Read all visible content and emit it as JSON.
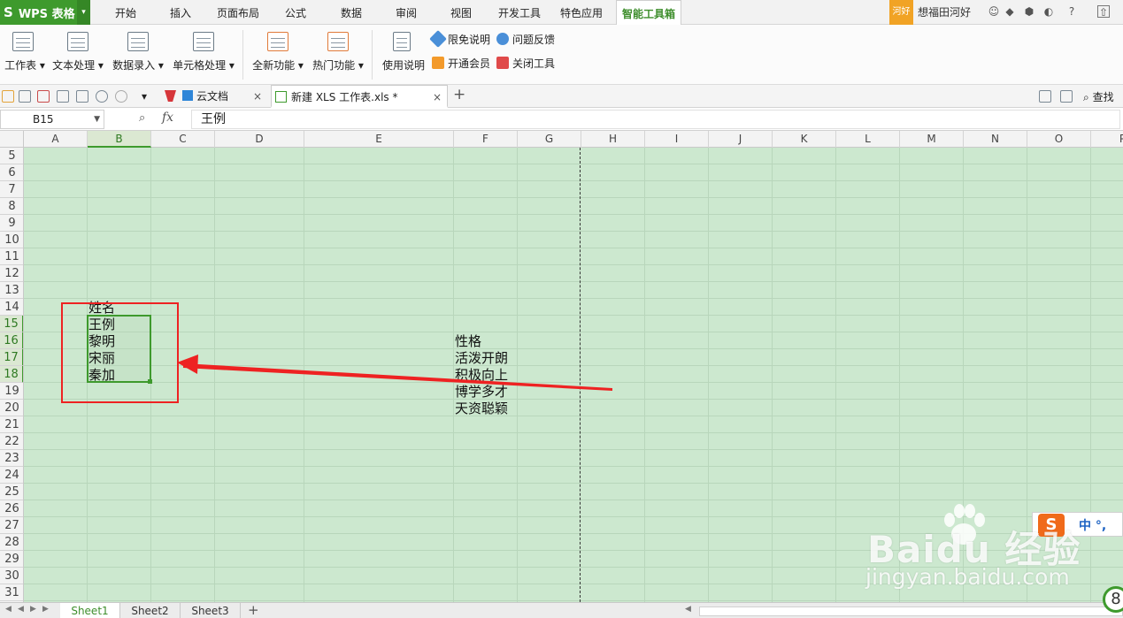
{
  "app": {
    "logo": "S",
    "name": "WPS 表格",
    "caret": "▾"
  },
  "menu": {
    "tabs": [
      {
        "label": "开始"
      },
      {
        "label": "插入"
      },
      {
        "label": "页面布局"
      },
      {
        "label": "公式"
      },
      {
        "label": "数据"
      },
      {
        "label": "审阅"
      },
      {
        "label": "视图"
      },
      {
        "label": "开发工具"
      },
      {
        "label": "特色应用"
      },
      {
        "label": "智能工具箱",
        "active": true
      }
    ],
    "user_badge": "河好",
    "user_name": "想福田河好"
  },
  "ribbon": {
    "groups": [
      {
        "label": "工作表 ▾"
      },
      {
        "label": "文本处理 ▾"
      },
      {
        "label": "数据录入 ▾"
      },
      {
        "label": "单元格处理 ▾"
      },
      {
        "label": "全新功能 ▾"
      },
      {
        "label": "热门功能 ▾"
      },
      {
        "label": "使用说明"
      }
    ],
    "links": [
      {
        "label": "限免说明",
        "color": "#4a8fd8"
      },
      {
        "label": "问题反馈",
        "color": "#4a8fd8"
      },
      {
        "label": "开通会员",
        "color": "#f39a2b"
      },
      {
        "label": "关闭工具",
        "color": "#e04a4a"
      }
    ]
  },
  "doc_tabs": [
    {
      "label": "云文档",
      "close": "×"
    },
    {
      "label": "新建 XLS 工作表.xls *",
      "close": "×",
      "active": true
    }
  ],
  "toolbar": {
    "add_tab": "+",
    "search_label": "查找"
  },
  "formula_bar": {
    "cell_ref": "B15",
    "fx": "fx",
    "value": "王例"
  },
  "columns": [
    "A",
    "B",
    "C",
    "D",
    "E",
    "F",
    "G",
    "H",
    "I",
    "J",
    "K",
    "L",
    "M",
    "N",
    "O",
    "P"
  ],
  "selected_column": "B",
  "rows": [
    "5",
    "6",
    "7",
    "8",
    "9",
    "10",
    "11",
    "12",
    "13",
    "14",
    "15",
    "16",
    "17",
    "18",
    "19",
    "20",
    "21",
    "22",
    "23",
    "24",
    "25",
    "26",
    "27",
    "28",
    "29",
    "30",
    "31"
  ],
  "selected_rows": [
    "15",
    "16",
    "17",
    "18"
  ],
  "cells": {
    "b14": "姓名",
    "b15": "王例",
    "b16": "黎明",
    "b17": "宋丽",
    "b18": "秦加",
    "f15": "性格",
    "f16": "活泼开朗",
    "f17": "积极向上",
    "f18": "博学多才",
    "f19": "天资聪颖"
  },
  "annotation": {
    "box_color": "#ee2222",
    "arrow_color": "#ee2222"
  },
  "sheets": [
    {
      "label": "Sheet1",
      "active": true
    },
    {
      "label": "Sheet2"
    },
    {
      "label": "Sheet3"
    }
  ],
  "sheet_add": "+",
  "ime": {
    "logo": "S",
    "text": "中 °,"
  },
  "watermark": {
    "brand": "Baidu 经验",
    "url": "jingyan.baidu.com"
  },
  "corner_badge": "8",
  "colors": {
    "accent_green": "#3e9a2d",
    "sheet_bg": "#cce8cf",
    "active_tab_text": "#3e8e2c"
  }
}
